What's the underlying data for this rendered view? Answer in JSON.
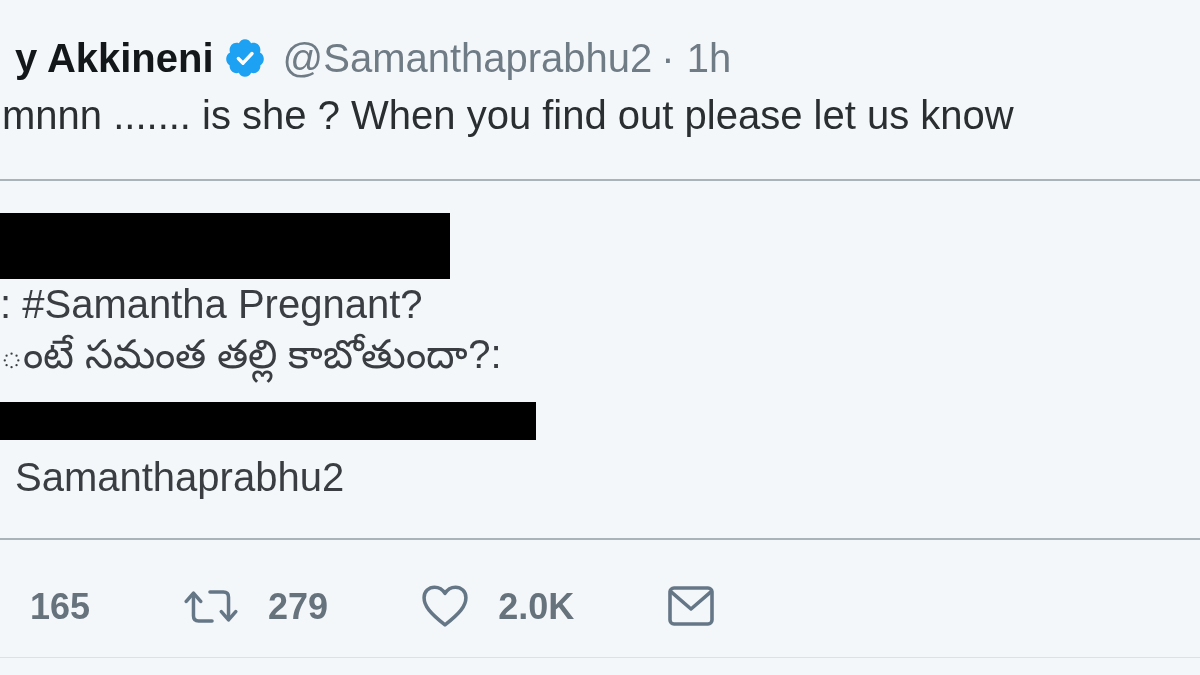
{
  "tweet": {
    "display_name": "y Akkineni",
    "verified": true,
    "handle": "@Samanthaprabhu2",
    "separator": "·",
    "time": "1h",
    "text": "mnnn ....... is she ? When you find out please let us know",
    "quoted_tweet": {
      "header_redacted": true,
      "lines": [
        {
          "kind": "text",
          "text": ": #Samantha Pregnant?"
        },
        {
          "kind": "text",
          "text": "ంటే సమంత తల్లి కాబోతుందా?:"
        },
        {
          "kind": "redacted"
        },
        {
          "kind": "text",
          "text": "Samanthaprabhu2"
        }
      ]
    },
    "actions": [
      {
        "kind": "reply",
        "count": "165"
      },
      {
        "kind": "retweet",
        "count": "279"
      },
      {
        "kind": "like",
        "count": "2.0K"
      },
      {
        "kind": "message"
      }
    ]
  }
}
